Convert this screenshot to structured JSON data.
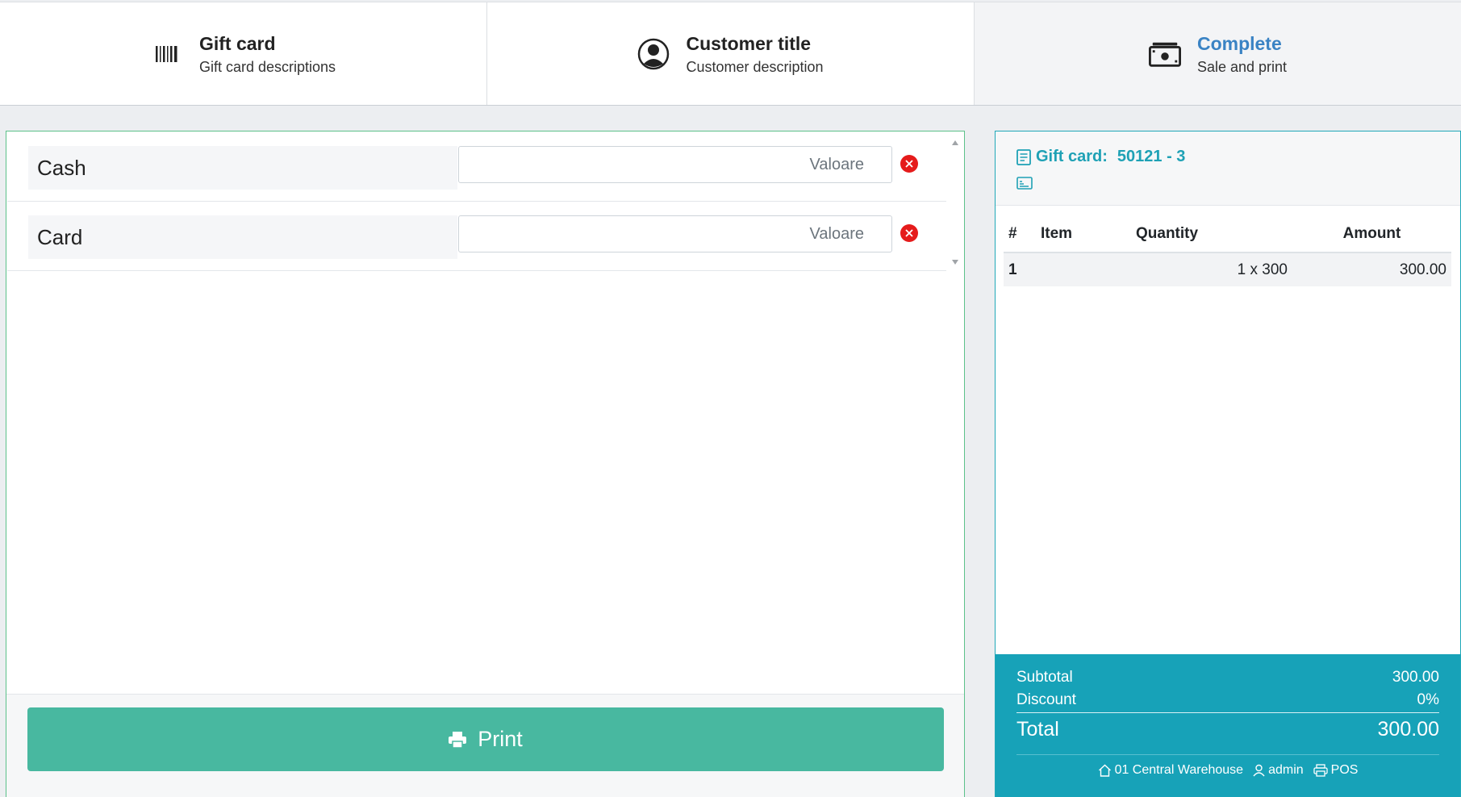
{
  "steps": [
    {
      "title": "Gift card",
      "description": "Gift card descriptions",
      "icon": "barcode-icon",
      "active": false
    },
    {
      "title": "Customer title",
      "description": "Customer description",
      "icon": "user-circle-icon",
      "active": false
    },
    {
      "title": "Complete",
      "description": "Sale and print",
      "icon": "cash-icon",
      "active": true
    }
  ],
  "payments": {
    "rows": [
      {
        "label": "Cash",
        "placeholder": "Valoare",
        "value": ""
      },
      {
        "label": "Card",
        "placeholder": "Valoare",
        "value": ""
      }
    ],
    "print_label": "Print"
  },
  "receipt": {
    "title_label": "Gift card:",
    "title_value": "50121 - 3",
    "columns": [
      "#",
      "Item",
      "Quantity",
      "Amount"
    ],
    "rows": [
      {
        "num": "1",
        "item": "",
        "quantity": "1 x 300",
        "amount": "300.00"
      }
    ],
    "subtotal_label": "Subtotal",
    "subtotal_value": "300.00",
    "discount_label": "Discount",
    "discount_value": "0%",
    "total_label": "Total",
    "total_value": "300.00",
    "footer": {
      "warehouse": "01 Central Warehouse",
      "user": "admin",
      "terminal": "POS"
    }
  },
  "colors": {
    "accent_green": "#48b8a0",
    "accent_teal": "#17a2b8",
    "active_step": "#3a83c4",
    "remove_red": "#e51b1b"
  }
}
